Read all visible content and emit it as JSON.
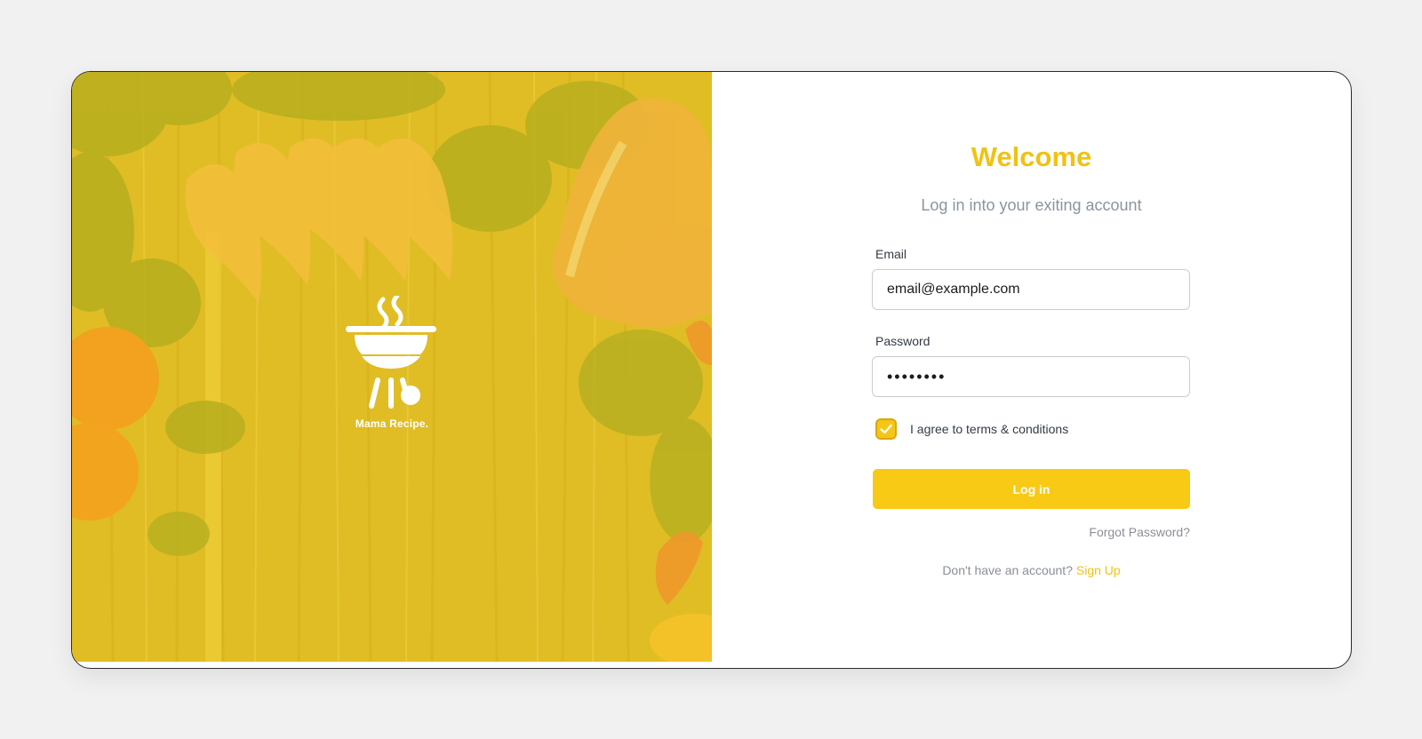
{
  "brand": {
    "name": "Mama Recipe.",
    "logo_icon": "grill-icon",
    "hero_image": "food-ingredients-photo"
  },
  "login": {
    "title": "Welcome",
    "subtitle": "Log in into your exiting account",
    "email": {
      "label": "Email",
      "value": "email@example.com"
    },
    "password": {
      "label": "Password",
      "value": "••••••••"
    },
    "terms": {
      "label": "I agree to terms & conditions",
      "checked": true
    },
    "submit_label": "Log in",
    "forgot_label": "Forgot Password?",
    "no_account_text": "Don't have an account?",
    "signup_label": "Sign Up"
  },
  "colors": {
    "accent": "#efc214",
    "button": "#f8c915",
    "hero_overlay": "#e2c12a",
    "page_bg": "#f1f1f1"
  }
}
